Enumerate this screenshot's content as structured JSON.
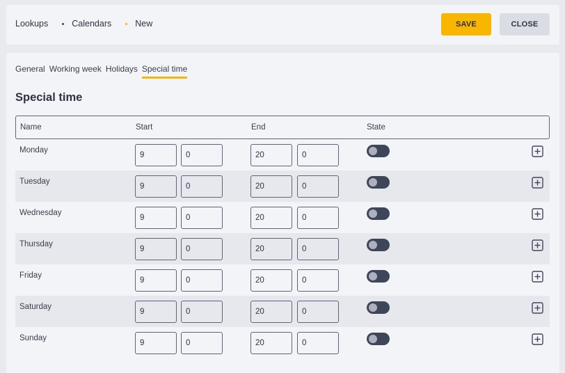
{
  "breadcrumb": {
    "items": [
      {
        "label": "Lookups"
      },
      {
        "label": "Calendars"
      },
      {
        "label": "New"
      }
    ]
  },
  "toolbar": {
    "save_label": "SAVE",
    "close_label": "CLOSE"
  },
  "tabs": [
    {
      "label": "General"
    },
    {
      "label": "Working week"
    },
    {
      "label": "Holidays"
    },
    {
      "label": "Special time",
      "active": true
    }
  ],
  "section": {
    "title": "Special time"
  },
  "table": {
    "headers": {
      "name": "Name",
      "start": "Start",
      "end": "End",
      "state": "State"
    },
    "rows": [
      {
        "day": "Monday",
        "start_hour": "9",
        "start_min": "0",
        "end_hour": "20",
        "end_min": "0",
        "state": false
      },
      {
        "day": "Tuesday",
        "start_hour": "9",
        "start_min": "0",
        "end_hour": "20",
        "end_min": "0",
        "state": false
      },
      {
        "day": "Wednesday",
        "start_hour": "9",
        "start_min": "0",
        "end_hour": "20",
        "end_min": "0",
        "state": false
      },
      {
        "day": "Thursday",
        "start_hour": "9",
        "start_min": "0",
        "end_hour": "20",
        "end_min": "0",
        "state": false
      },
      {
        "day": "Friday",
        "start_hour": "9",
        "start_min": "0",
        "end_hour": "20",
        "end_min": "0",
        "state": false
      },
      {
        "day": "Saturday",
        "start_hour": "9",
        "start_min": "0",
        "end_hour": "20",
        "end_min": "0",
        "state": false
      },
      {
        "day": "Sunday",
        "start_hour": "9",
        "start_min": "0",
        "end_hour": "20",
        "end_min": "0",
        "state": false
      }
    ]
  },
  "colors": {
    "accent": "#f8b600",
    "dark": "#40465a",
    "border": "#5e6378"
  },
  "icons": {
    "row_action": "plus-square-icon"
  }
}
